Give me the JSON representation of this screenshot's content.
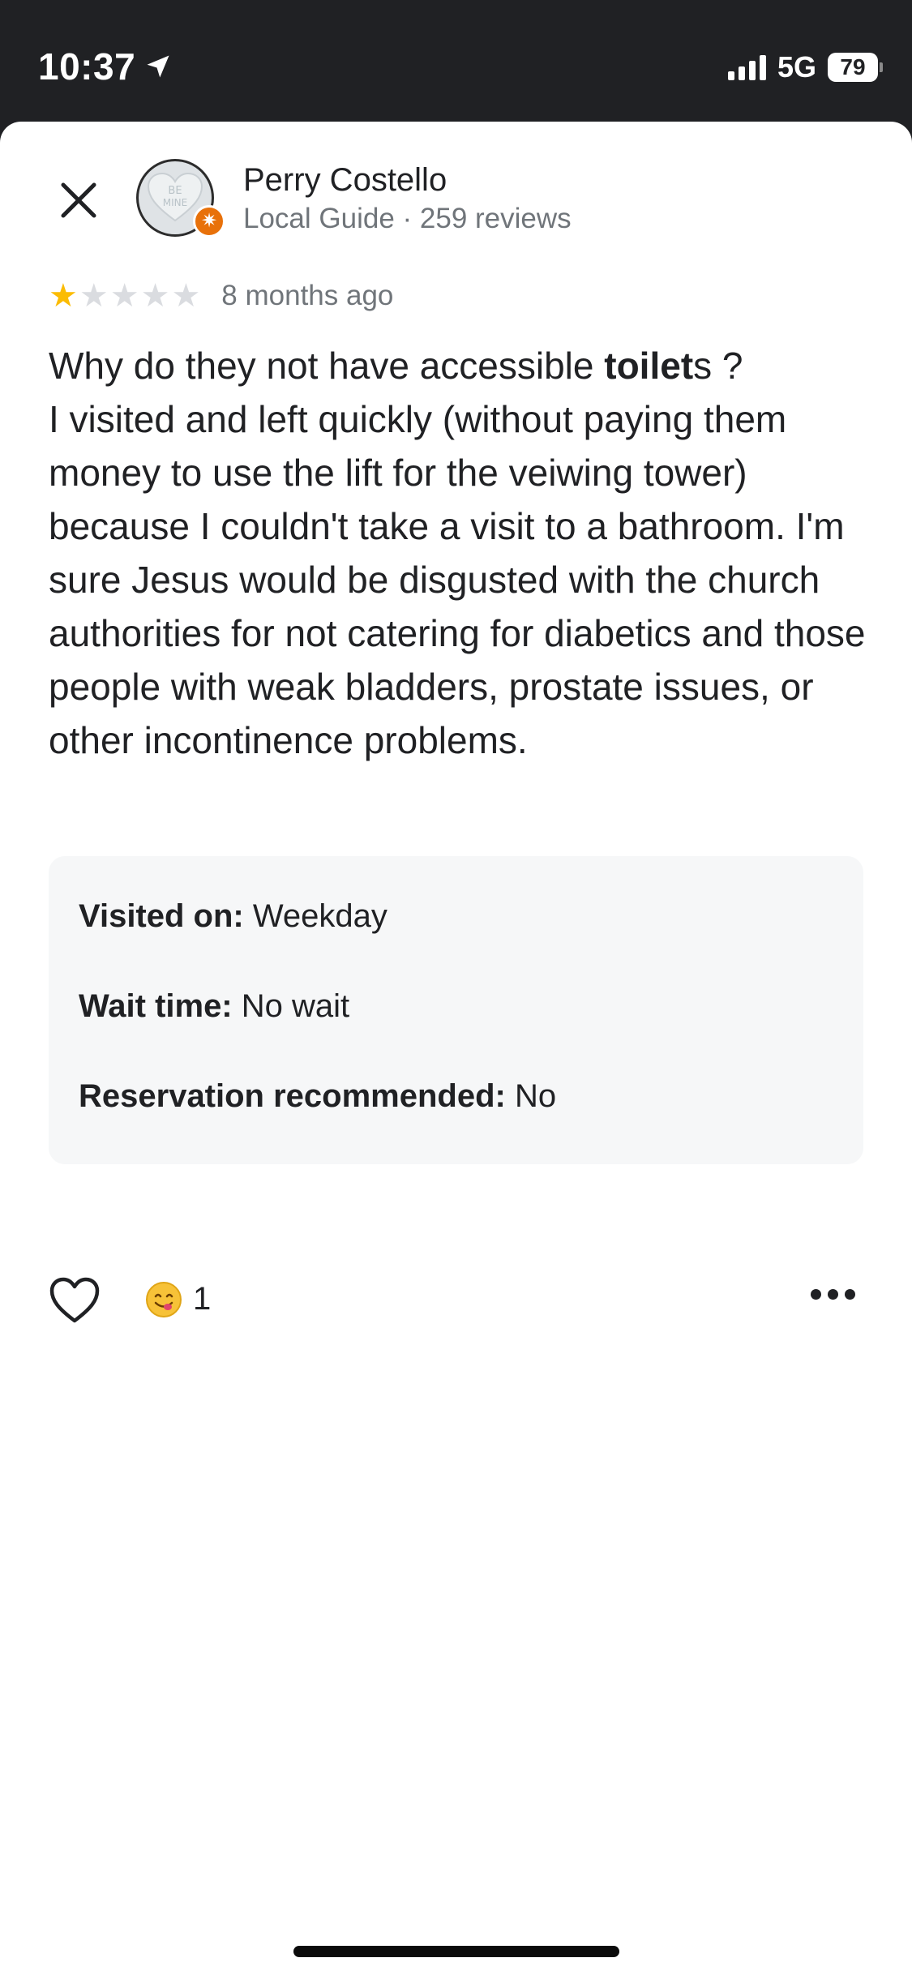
{
  "status_bar": {
    "time": "10:37",
    "network": "5G",
    "battery": "79"
  },
  "review": {
    "reviewer_name": "Perry Costello",
    "reviewer_meta": "Local Guide · 259 reviews",
    "avatar_text": "BE MINE",
    "rating": 1,
    "rating_max": 5,
    "date": "8 months ago",
    "text_before_bold": "Why do they not have accessible ",
    "text_bold": "toilet",
    "text_after_bold": "s ?\nI visited and left quickly (without paying them money to use the lift for the veiwing tower) because I couldn't take a visit to a bathroom. I'm sure Jesus would be disgusted with the church authorities for not catering for diabetics and those people with weak bladders, prostate issues, or other incontinence problems."
  },
  "details": [
    {
      "label": "Visited on:",
      "value": " Weekday"
    },
    {
      "label": "Wait time:",
      "value": " No wait"
    },
    {
      "label": "Reservation recommended:",
      "value": " No"
    }
  ],
  "actions": {
    "reaction_count": "1",
    "like_icon": "heart-outline-icon",
    "reaction_icon": "yum-face-emoji",
    "more_icon": "more-horizontal-icon"
  },
  "colors": {
    "star_on": "#fbbc04",
    "star_off": "#dadce0",
    "badge": "#e8710a",
    "card_bg": "#f6f7f8"
  }
}
